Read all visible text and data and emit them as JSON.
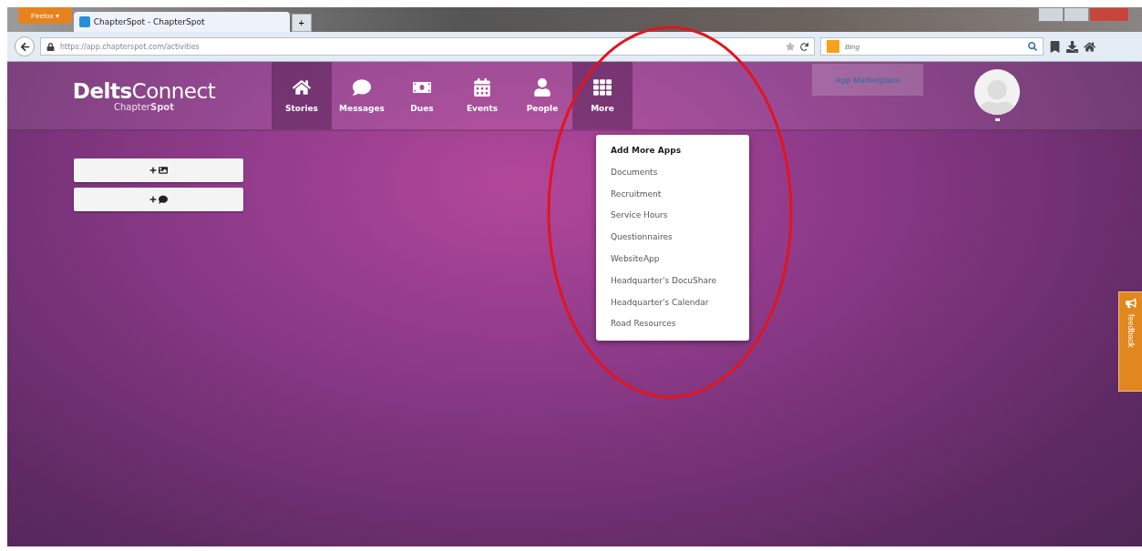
{
  "browser": {
    "menu_button": "Firefox ▾",
    "tab": {
      "title": "ChapterSpot - ChapterSpot",
      "selected": true
    },
    "new_tab": "+",
    "url": "https://app.chapterspot.com/activities",
    "search": {
      "placeholder": "Bing"
    }
  },
  "logo": {
    "title": "**Delts**Connect",
    "subtitle": "Chapter**Spot**"
  },
  "nav": [
    {
      "label": "Stories",
      "selected": true
    },
    {
      "label": "Messages",
      "selected": false
    },
    {
      "label": "Dues",
      "selected": false
    },
    {
      "label": "Events",
      "selected": false
    },
    {
      "label": "People",
      "selected": false
    },
    {
      "label": "More",
      "selected": true
    }
  ],
  "marketplace_button": "App Marketplace",
  "compose_buttons": [
    {
      "kind": "photo"
    },
    {
      "kind": "message"
    }
  ],
  "more_menu": [
    {
      "label": "Add More Apps",
      "kind": "header"
    },
    {
      "label": "Documents",
      "kind": "item"
    },
    {
      "label": "Recruitment",
      "kind": "item"
    },
    {
      "label": "Service Hours",
      "kind": "item"
    },
    {
      "label": "Questionnaires",
      "kind": "item"
    },
    {
      "label": "WebsiteApp",
      "kind": "item"
    },
    {
      "label": "Headquarter's DocuShare",
      "kind": "item"
    },
    {
      "label": "Headquarter's Calendar",
      "kind": "item"
    },
    {
      "label": "Road Resources",
      "kind": "item"
    }
  ],
  "feedback_tab": "feedback"
}
